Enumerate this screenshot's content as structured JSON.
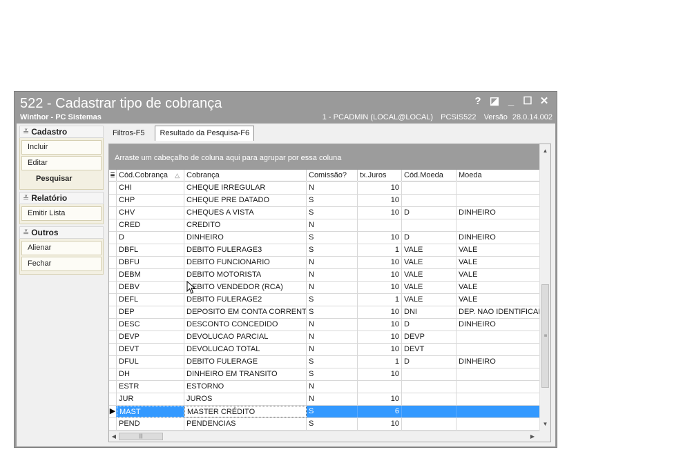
{
  "window": {
    "title": "522 - Cadastrar tipo de cobrança",
    "subtitle": "Winthor - PC Sistemas",
    "user": "1 - PCADMIN (LOCAL@LOCAL)",
    "routine": "PCSIS522",
    "version_label": "Versão",
    "version": "28.0.14.002",
    "buttons": {
      "help": "?",
      "restore": "◪",
      "minimize": "_",
      "maximize": "☐",
      "close": "✕"
    }
  },
  "sidebar": {
    "groups": [
      {
        "title": "Cadastro",
        "items": [
          "Incluir",
          "Editar"
        ]
      },
      {
        "title": "Pesquisar",
        "items": []
      },
      {
        "title": "Relatório",
        "items": [
          "Emitir Lista"
        ]
      },
      {
        "title": "Outros",
        "items": [
          "Alienar",
          "Fechar"
        ]
      }
    ]
  },
  "tabs": [
    "Filtros-F5",
    "Resultado da Pesquisa-F6"
  ],
  "grid": {
    "group_hint": "Arraste um cabeçalho de coluna aqui para agrupar por essa coluna",
    "columns": [
      "Cód.Cobrança",
      "Cobrança",
      "Comissão?",
      "tx.Juros",
      "Cód.Moeda",
      "Moeda"
    ],
    "selected_index": 20,
    "rows": [
      [
        "CHI",
        "CHEQUE IRREGULAR",
        "N",
        "10",
        "",
        ""
      ],
      [
        "CHP",
        "CHEQUE PRE DATADO",
        "S",
        "10",
        "",
        ""
      ],
      [
        "CHV",
        "CHEQUES A VISTA",
        "S",
        "10",
        "D",
        "DINHEIRO"
      ],
      [
        "CRED",
        "CREDITO",
        "N",
        "",
        "",
        ""
      ],
      [
        "D",
        "DINHEIRO",
        "S",
        "10",
        "D",
        "DINHEIRO"
      ],
      [
        "DBFL",
        "DEBITO FULERAGE3",
        "S",
        "1",
        "VALE",
        "VALE"
      ],
      [
        "DBFU",
        "DEBITO FUNCIONARIO",
        "N",
        "10",
        "VALE",
        "VALE"
      ],
      [
        "DEBM",
        "DEBITO MOTORISTA",
        "N",
        "10",
        "VALE",
        "VALE"
      ],
      [
        "DEBV",
        "DEBITO VENDEDOR (RCA)",
        "N",
        "10",
        "VALE",
        "VALE"
      ],
      [
        "DEFL",
        "DEBITO FULERAGE2",
        "S",
        "1",
        "VALE",
        "VALE"
      ],
      [
        "DEP",
        "DEPOSITO EM CONTA CORRENTE",
        "S",
        "10",
        "DNI",
        "DEP. NAO IDENTIFICADO"
      ],
      [
        "DESC",
        "DESCONTO CONCEDIDO",
        "N",
        "10",
        "D",
        "DINHEIRO"
      ],
      [
        "DEVP",
        "DEVOLUCAO PARCIAL",
        "N",
        "10",
        "DEVP",
        ""
      ],
      [
        "DEVT",
        "DEVOLUCAO TOTAL",
        "N",
        "10",
        "DEVT",
        ""
      ],
      [
        "DFUL",
        "DEBITO FULERAGE",
        "S",
        "1",
        "D",
        "DINHEIRO"
      ],
      [
        "DH",
        "DINHEIRO EM TRANSITO",
        "S",
        "10",
        "",
        ""
      ],
      [
        "ESTR",
        "ESTORNO",
        "N",
        "",
        "",
        ""
      ],
      [
        "JUR",
        "JUROS",
        "N",
        "10",
        "",
        ""
      ],
      [
        "MAST",
        "MASTER CRÉDITO",
        "S",
        "6",
        "",
        ""
      ],
      [
        "PEND",
        "PENDENCIAS",
        "S",
        "10",
        "",
        ""
      ]
    ]
  },
  "icons": {
    "column_chooser": "column-chooser-icon",
    "sort": "sort-ascending-icon",
    "row_pointer": "row-pointer-icon"
  }
}
